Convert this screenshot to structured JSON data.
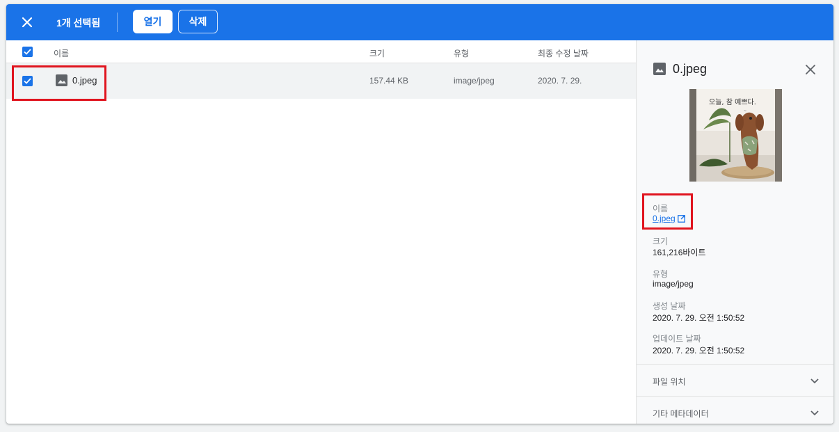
{
  "toolbar": {
    "close_icon": "close-icon",
    "selection_count": "1개 선택됨",
    "open_label": "열기",
    "delete_label": "삭제",
    "color": "#1a73e8"
  },
  "list": {
    "columns": {
      "name": "이름",
      "size": "크기",
      "type": "유형",
      "modified": "최종 수정 날짜"
    },
    "rows": [
      {
        "name": "0.jpeg",
        "size": "157.44 KB",
        "type": "image/jpeg",
        "modified": "2020. 7. 29.",
        "selected": true,
        "icon": "image-icon"
      }
    ]
  },
  "details": {
    "title": "0.jpeg",
    "thumbnail_caption": "오늘, 참 예쁘다.",
    "name_label": "이름",
    "name_value": "0.jpeg",
    "size_label": "크기",
    "size_value": "161,216바이트",
    "type_label": "유형",
    "type_value": "image/jpeg",
    "created_label": "생성 날짜",
    "created_value": "2020. 7. 29. 오전 1:50:52",
    "updated_label": "업데이트 날짜",
    "updated_value": "2020. 7. 29. 오전 1:50:52",
    "sections": [
      {
        "label": "파일 위치"
      },
      {
        "label": "기타 메타데이터"
      }
    ]
  }
}
